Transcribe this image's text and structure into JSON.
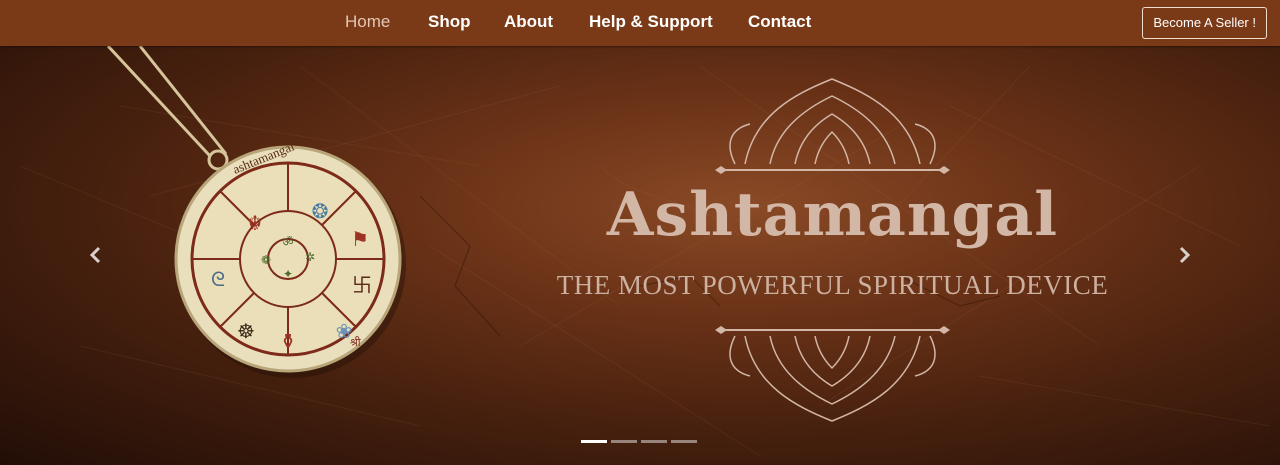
{
  "nav": {
    "items": [
      {
        "label": "Home",
        "active": true
      },
      {
        "label": "Shop"
      },
      {
        "label": "About"
      },
      {
        "label": "Help & Support"
      },
      {
        "label": "Contact"
      }
    ],
    "seller_button": "Become A Seller !"
  },
  "hero": {
    "title": "Ashtamangal",
    "subtitle": "THE MOST POWERFUL SPIRITUAL DEVICE",
    "medallion_text": "ashtamangal",
    "medallion_footer": "श्री",
    "slide_count": 4,
    "active_slide": 0
  },
  "colors": {
    "navbar": "#7a3a17",
    "text_light": "#d2b6a6"
  },
  "icons": {
    "prev": "chevron-left-icon",
    "next": "chevron-right-icon"
  }
}
